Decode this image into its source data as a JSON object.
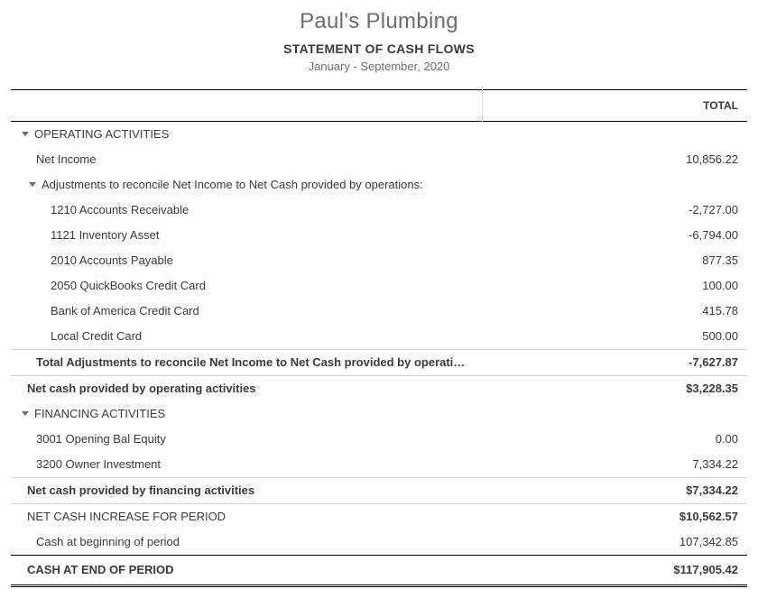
{
  "company_name": "Paul's Plumbing",
  "report_title": "STATEMENT OF CASH FLOWS",
  "period": "January - September, 2020",
  "column_header": "TOTAL",
  "operating": {
    "header": "OPERATING ACTIVITIES",
    "net_income_label": "Net Income",
    "net_income_value": "10,856.22",
    "adjustments_header": "Adjustments to reconcile Net Income to Net Cash provided by operations:",
    "rows": [
      {
        "label": "1210 Accounts Receivable",
        "value": "-2,727.00"
      },
      {
        "label": "1121 Inventory Asset",
        "value": "-6,794.00"
      },
      {
        "label": "2010 Accounts Payable",
        "value": "877.35"
      },
      {
        "label": "2050 QuickBooks Credit Card",
        "value": "100.00"
      },
      {
        "label": "Bank of America Credit Card",
        "value": "415.78"
      },
      {
        "label": "Local Credit Card",
        "value": "500.00"
      }
    ],
    "adjustments_total_label": "Total Adjustments to reconcile Net Income to Net Cash provided by operati…",
    "adjustments_total_value": "-7,627.87",
    "net_cash_label": "Net cash provided by operating activities",
    "net_cash_value": "$3,228.35"
  },
  "financing": {
    "header": "FINANCING ACTIVITIES",
    "rows": [
      {
        "label": "3001 Opening Bal Equity",
        "value": "0.00"
      },
      {
        "label": "3200 Owner Investment",
        "value": "7,334.22"
      }
    ],
    "net_cash_label": "Net cash provided by financing activities",
    "net_cash_value": "$7,334.22"
  },
  "net_increase_label": "NET CASH INCREASE FOR PERIOD",
  "net_increase_value": "$10,562.57",
  "beginning_label": "Cash at beginning of period",
  "beginning_value": "107,342.85",
  "ending_label": "CASH AT END OF PERIOD",
  "ending_value": "$117,905.42"
}
